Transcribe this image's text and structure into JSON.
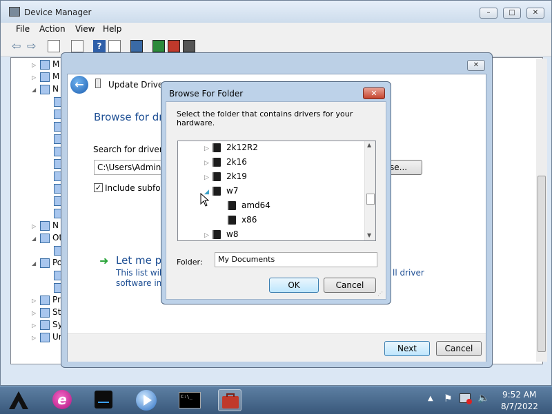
{
  "device_manager": {
    "title": "Device Manager",
    "menu": [
      "File",
      "Action",
      "View",
      "Help"
    ],
    "tree_rows": [
      {
        "label": "M",
        "expanded": false
      },
      {
        "label": "M",
        "expanded": false
      },
      {
        "label": "N",
        "expanded": true
      },
      {
        "label": "",
        "child": true
      },
      {
        "label": "",
        "child": true
      },
      {
        "label": "",
        "child": true
      },
      {
        "label": "",
        "child": true
      },
      {
        "label": "",
        "child": true
      },
      {
        "label": "",
        "child": true
      },
      {
        "label": "",
        "child": true
      },
      {
        "label": "",
        "child": true
      },
      {
        "label": "",
        "child": true
      },
      {
        "label": "",
        "child": true
      },
      {
        "label": "N",
        "expanded": false
      },
      {
        "label": "Ot",
        "expanded": true
      },
      {
        "label": "",
        "child": true
      },
      {
        "label": "Po",
        "expanded": true
      },
      {
        "label": "",
        "child": true
      },
      {
        "label": "",
        "child": true
      },
      {
        "label": "Pr",
        "expanded": false
      },
      {
        "label": "St",
        "expanded": false
      },
      {
        "label": "Sy",
        "expanded": false
      },
      {
        "label": "Ur",
        "expanded": false
      }
    ]
  },
  "wizard": {
    "title": "Update Driver S",
    "heading": "Browse for dri",
    "search_label": "Search for driver so",
    "path_value": "C:\\Users\\Adminis",
    "browse_label": "se...",
    "include_subfolders": "Include subfold",
    "let_me_pick": "Let me pi",
    "desc_line1": "This list will s",
    "desc_line1_tail": "ll driver",
    "desc_line2": "software in t",
    "next_label": "Next",
    "cancel_label": "Cancel"
  },
  "browse_dialog": {
    "title": "Browse For Folder",
    "instruction": "Select the folder that contains drivers for your hardware.",
    "folders": [
      {
        "name": "2k12R2",
        "indent": 0,
        "expander": "collapsed"
      },
      {
        "name": "2k16",
        "indent": 0,
        "expander": "collapsed"
      },
      {
        "name": "2k19",
        "indent": 0,
        "expander": "collapsed"
      },
      {
        "name": "w7",
        "indent": 0,
        "expander": "expanded"
      },
      {
        "name": "amd64",
        "indent": 1,
        "expander": "none"
      },
      {
        "name": "x86",
        "indent": 1,
        "expander": "none"
      },
      {
        "name": "w8",
        "indent": 0,
        "expander": "collapsed"
      }
    ],
    "folder_label": "Folder:",
    "folder_value": "My Documents",
    "ok_label": "OK",
    "cancel_label": "Cancel"
  },
  "taskbar": {
    "time": "9:52 AM",
    "date": "8/7/2022",
    "apps": [
      "app-logo-icon",
      "internet-explorer-icon",
      "drive-icon",
      "media-player-icon",
      "command-prompt-icon",
      "toolbox-icon"
    ]
  },
  "colors": {
    "link_blue": "#1e4f94",
    "default_button": "#3c7fb1",
    "green_arrow": "#2aa43a"
  }
}
